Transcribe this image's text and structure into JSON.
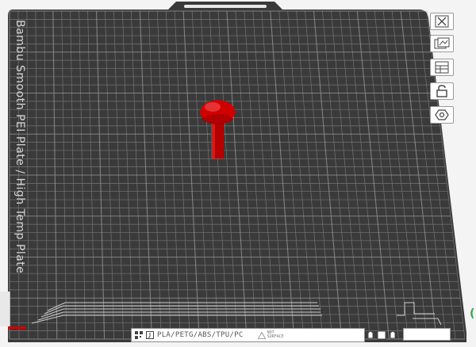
{
  "plate": {
    "name": "Bambu Smooth PEI Plate / High Temp Plate",
    "filament_types": "PLA/PETG/ABS/TPU/PC",
    "no_surface_line1": "NOT",
    "no_surface_line2": "SURFACE"
  },
  "toolbar": {
    "buttons": [
      {
        "name": "close-view-icon"
      },
      {
        "name": "plate-image-icon"
      },
      {
        "name": "arrange-icon"
      },
      {
        "name": "lock-icon"
      },
      {
        "name": "settings-hex-icon"
      }
    ]
  },
  "model": {
    "color": "#cc0000"
  },
  "colors": {
    "plate": "#3b3b3b",
    "grid": "#7a7a7a",
    "background": "#f4f4f4",
    "accent_green": "#2fa84f"
  }
}
